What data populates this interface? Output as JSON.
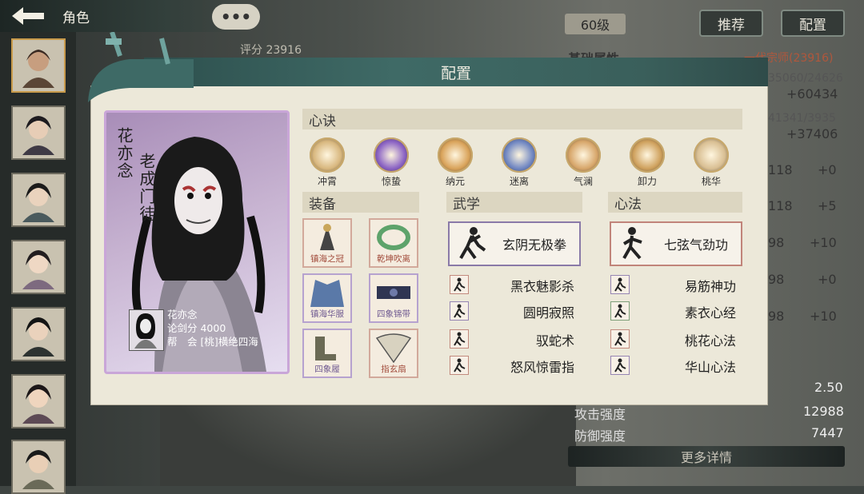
{
  "topbar": {
    "title": "角色"
  },
  "header_right": {
    "level": "60级",
    "recommend": "推荐",
    "config": "配置"
  },
  "bg_score": "评分 23916",
  "bg_panel": {
    "base_attr": "基础属性",
    "rank": "一代宗师(23916)",
    "rows": [
      {
        "a": "35060/24626",
        "b": "+60434"
      },
      {
        "a": "41341/3935",
        "b": "+37406"
      },
      {
        "a": "118",
        "b": "+0"
      },
      {
        "a": "118",
        "b": "+5"
      },
      {
        "a": "98",
        "b": "+10"
      },
      {
        "a": "98",
        "b": "+0"
      },
      {
        "a": "98",
        "b": "+10"
      }
    ],
    "extra": [
      {
        "label": "",
        "value": "2.50"
      },
      {
        "label": "攻击强度",
        "value": "12988"
      },
      {
        "label": "防御强度",
        "value": "7447"
      }
    ],
    "more": "更多详情"
  },
  "dialog": {
    "title": "配置",
    "character": {
      "name": "花亦念",
      "title": "老成门徒",
      "info_name": "花亦念",
      "info_score": "论剑分 4000",
      "info_guild": "帮　会 [桃]横绝四海"
    },
    "xinjue": {
      "header": "心诀",
      "items": [
        {
          "label": "冲霄",
          "color": "#d8b77e"
        },
        {
          "label": "惊蛰",
          "color": "#8a62c4"
        },
        {
          "label": "纳元",
          "color": "#d9a35a"
        },
        {
          "label": "迷离",
          "color": "#6f86c2"
        },
        {
          "label": "气澜",
          "color": "#d7a66a"
        },
        {
          "label": "卸力",
          "color": "#cfa15d"
        },
        {
          "label": "桃华",
          "color": "#d9bf93"
        }
      ]
    },
    "equipment": {
      "header": "装备",
      "items": [
        {
          "label": "镇海之冠"
        },
        {
          "label": "乾坤吹离"
        },
        {
          "label": "镇海华服"
        },
        {
          "label": "四象锦带"
        },
        {
          "label": "四象履"
        },
        {
          "label": "指玄扇"
        }
      ]
    },
    "wuxue": {
      "header": "武学",
      "main": "玄阴无极拳",
      "list": [
        "黑衣魅影杀",
        "圆明寂照",
        "驭蛇术",
        "怒风惊雷指"
      ]
    },
    "xinfa": {
      "header": "心法",
      "main": "七弦气劲功",
      "list": [
        "易筋神功",
        "素衣心经",
        "桃花心法",
        "华山心法"
      ]
    }
  }
}
